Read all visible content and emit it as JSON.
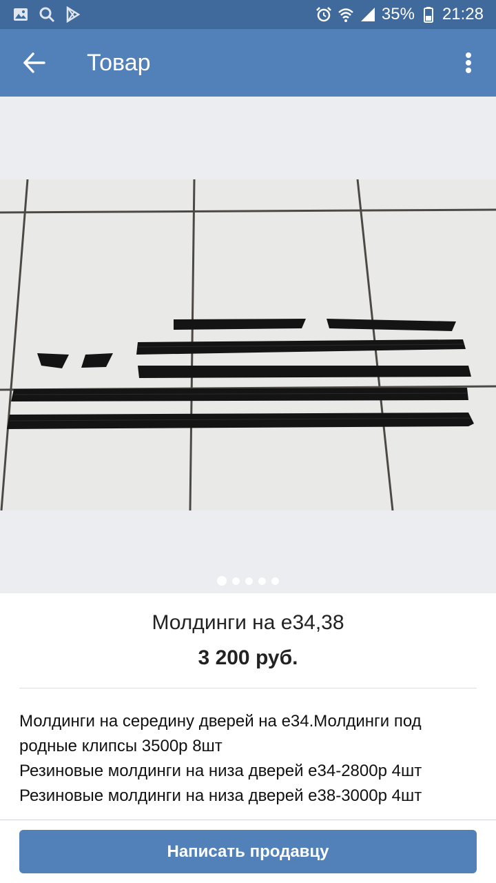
{
  "status_bar": {
    "battery_text": "35%",
    "time": "21:28",
    "icons_left": [
      "gallery-icon",
      "search-icon",
      "play-store-icon"
    ],
    "icons_right": [
      "alarm-icon",
      "wifi-icon",
      "signal-icon",
      "battery-icon"
    ]
  },
  "app_bar": {
    "title": "Товар",
    "back_icon": "arrow-left-icon",
    "menu_icon": "more-vertical-icon",
    "color": "#5181b8"
  },
  "gallery": {
    "photo_subject": "black car door moldings on tile floor",
    "page_count": 5,
    "current_page": 1
  },
  "product": {
    "title": "Молдинги на е34,38",
    "price": "3 200 руб.",
    "description_lines": [
      "Молдинги на середину  дверей на е34.Молдинги под",
      "родные клипсы 3500р 8шт",
      "Резиновые молдинги на низа дверей е34-2800р  4шт",
      "Резиновые молдинги на низа дверей е38-3000р  4шт"
    ]
  },
  "actions": {
    "contact_seller_label": "Написать продавцу"
  }
}
